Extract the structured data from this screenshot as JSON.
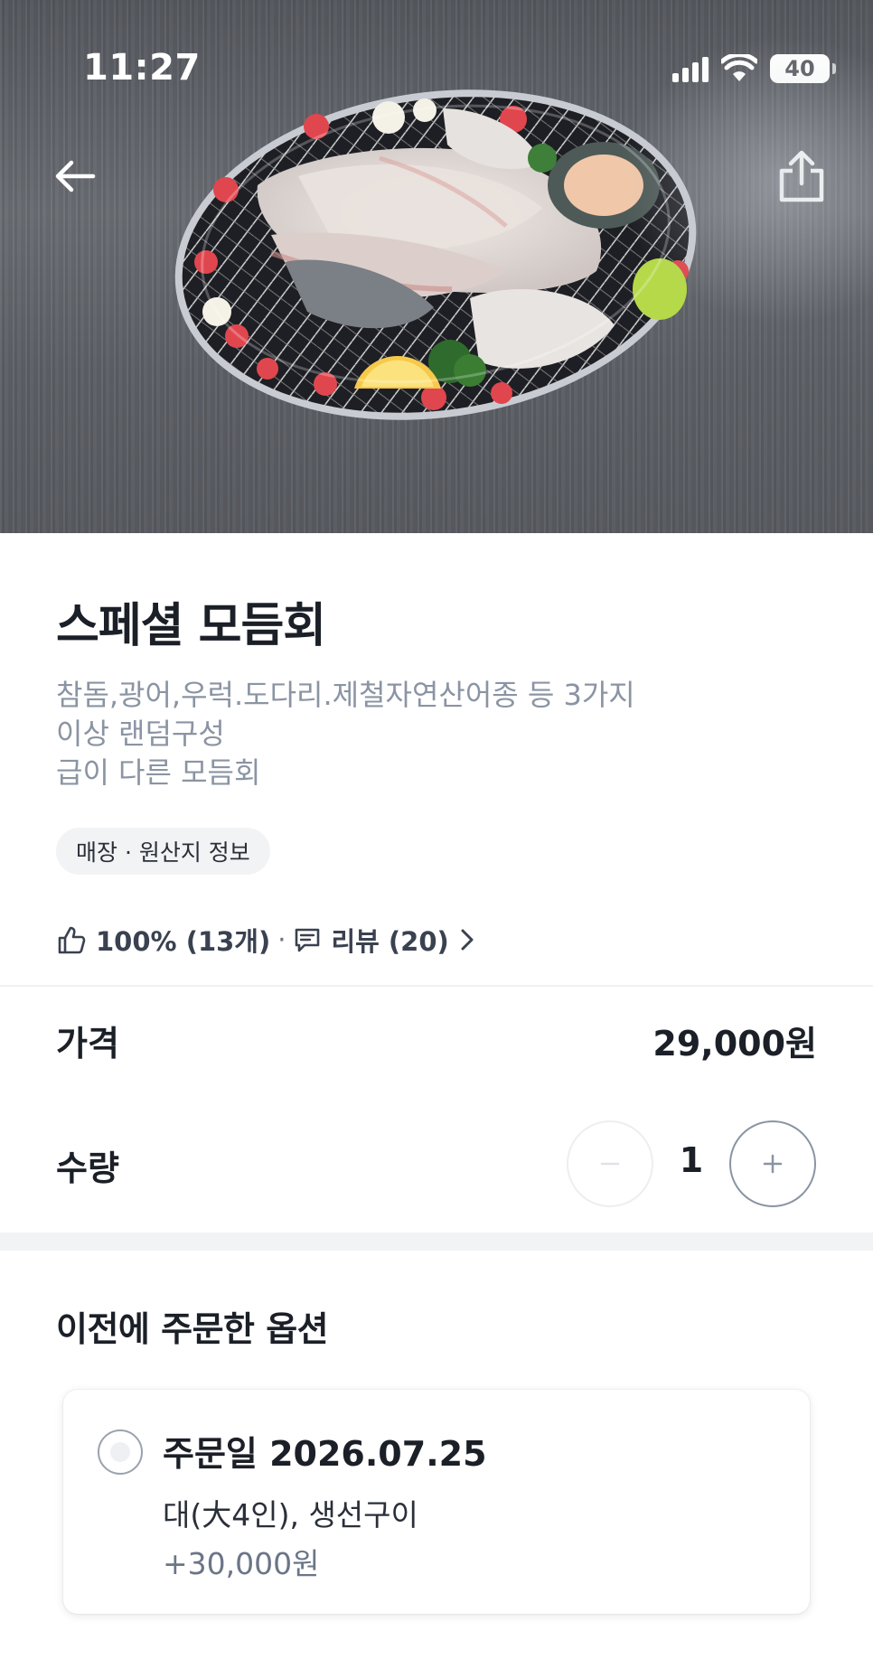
{
  "status_bar": {
    "time": "11:27",
    "battery": "40"
  },
  "hero": {
    "background": "#5d6066",
    "icons": [
      "back-arrow-icon",
      "share-icon"
    ]
  },
  "product": {
    "title": "스페셜 모듬회",
    "description_lines": [
      "참돔,광어,우럭.도다리.제철자연산어종 등 3가지",
      "이상 랜덤구성",
      "급이 다른 모듬회"
    ],
    "origin_chip": "매장 · 원산지 정보",
    "rating": "100% (13개)",
    "separator": "·",
    "review": "리뷰 (20)"
  },
  "price": {
    "label": "가격",
    "value": "29,000원"
  },
  "quantity": {
    "label": "수량",
    "value": "1"
  },
  "previous_options": {
    "title": "이전에 주문한 옵션",
    "order": {
      "date": "주문일 2026.07.25",
      "detail": "대(大4인), 생선구이",
      "price": "+30,000원"
    }
  },
  "colors": {
    "text_primary": "#1b1f27",
    "text_secondary": "#8a94a3",
    "chip_bg": "#f2f3f5"
  }
}
